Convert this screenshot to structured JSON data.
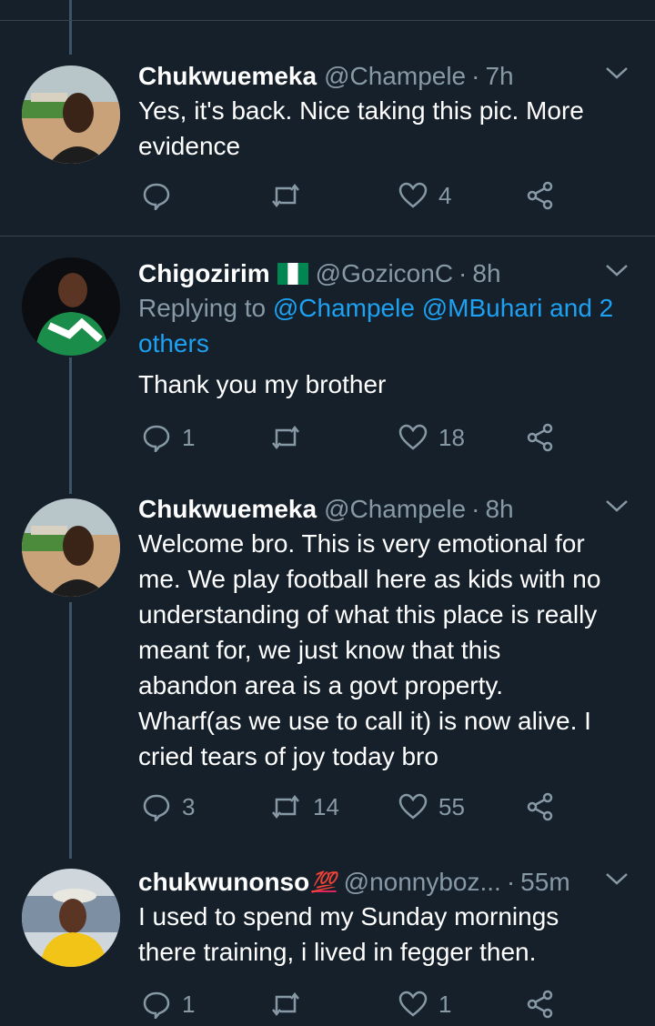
{
  "tweets": [
    {
      "name": "Chukwuemeka",
      "handle": "@Champele",
      "dot": "·",
      "time": "7h",
      "text_lines": [
        "Yes, it's back. Nice taking this pic. More",
        "evidence"
      ],
      "replies": "",
      "retweets": "",
      "likes": "4"
    },
    {
      "name": "Chigozirim",
      "flag_icon": "nigeria-flag-icon",
      "handle": "@GoziconC",
      "dot": "·",
      "time": "8h",
      "replying_prefix": "Replying to ",
      "replying_mentions": "@Champele @MBuhari and 2",
      "replying_mentions_2": "others",
      "text_lines": [
        "Thank you my brother"
      ],
      "replies": "1",
      "retweets": "",
      "likes": "18"
    },
    {
      "name": "Chukwuemeka",
      "handle": "@Champele",
      "dot": "·",
      "time": "8h",
      "text_lines": [
        "Welcome bro. This is very emotional for",
        "me. We play football here as kids with no",
        "understanding of what this place is really",
        "meant for, we just know that this",
        "abandon area is a govt property.",
        "Wharf(as we use to call it) is now alive. I",
        "cried tears of joy today bro"
      ],
      "replies": "3",
      "retweets": "14",
      "likes": "55"
    },
    {
      "name": "chukwunonso",
      "badge": "💯",
      "handle": "@nonnyboz...",
      "dot": "·",
      "time": "55m",
      "text_lines": [
        "I used to spend my Sunday mornings",
        "there training, i lived in fegger then."
      ],
      "replies": "1",
      "retweets": "",
      "likes": "1"
    }
  ],
  "colors": {
    "background": "#15202b",
    "secondary_text": "#8899a6",
    "link": "#1da1f2",
    "divider": "#38444d"
  }
}
